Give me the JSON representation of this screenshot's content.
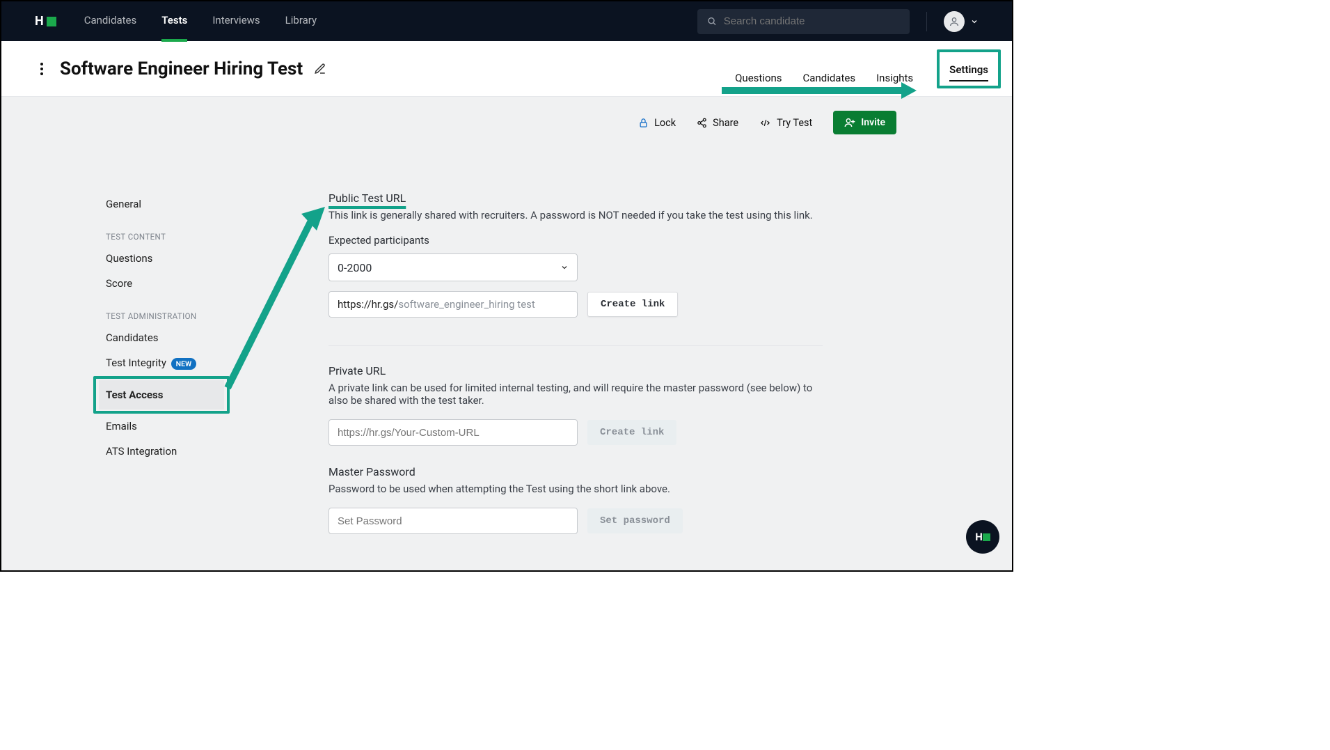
{
  "nav": {
    "links": [
      "Candidates",
      "Tests",
      "Interviews",
      "Library"
    ],
    "active": "Tests",
    "search_placeholder": "Search candidate"
  },
  "header": {
    "title": "Software Engineer Hiring Test",
    "tabs": [
      "Questions",
      "Candidates",
      "Insights",
      "Settings"
    ],
    "active_tab": "Settings"
  },
  "actions": {
    "lock": "Lock",
    "share": "Share",
    "try": "Try Test",
    "invite": "Invite"
  },
  "sidebar": {
    "general": "General",
    "heading_content": "TEST CONTENT",
    "questions": "Questions",
    "score": "Score",
    "heading_admin": "TEST ADMINISTRATION",
    "candidates": "Candidates",
    "integrity": "Test Integrity",
    "integrity_badge": "NEW",
    "access": "Test Access",
    "emails": "Emails",
    "ats": "ATS Integration"
  },
  "form": {
    "public": {
      "title": "Public Test URL",
      "desc": "This link is generally shared with recruiters. A password is NOT needed if you take the test using this link.",
      "expected_label": "Expected participants",
      "expected_value": "0-2000",
      "url_prefix": "https://hr.gs/",
      "url_suffix": "software_engineer_hiring test",
      "create": "Create link"
    },
    "private": {
      "title": "Private URL",
      "desc": "A private link can be used for limited internal testing, and will require the master password (see below) to also be shared with the test taker.",
      "placeholder": "https://hr.gs/Your-Custom-URL",
      "create": "Create link"
    },
    "master": {
      "title": "Master Password",
      "desc": "Password to be used when attempting the Test using the short link above.",
      "placeholder": "Set Password",
      "button": "Set password"
    }
  }
}
